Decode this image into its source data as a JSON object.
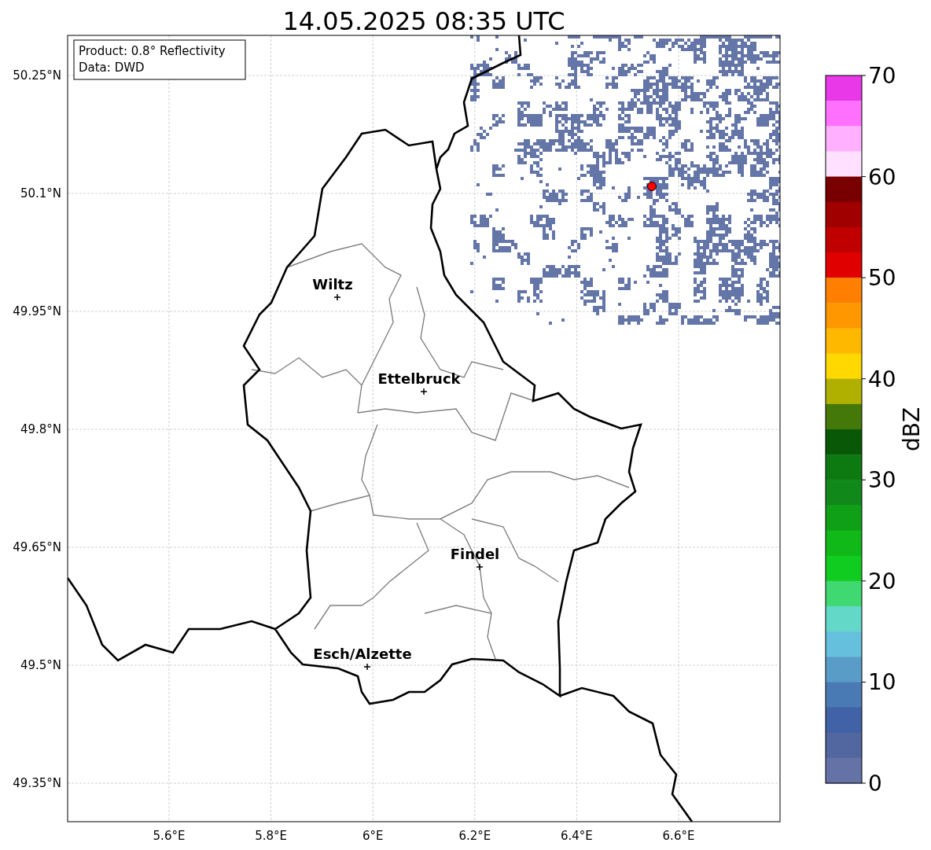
{
  "title": "14.05.2025 08:35 UTC",
  "map": {
    "x_tick_labels": [
      "5.6°E",
      "5.8°E",
      "6°E",
      "6.2°E",
      "6.4°E",
      "6.6°E"
    ],
    "y_tick_labels": [
      "50.25°N",
      "50.1°N",
      "49.95°N",
      "49.8°N",
      "49.65°N",
      "49.5°N",
      "49.35°N"
    ],
    "cities": [
      {
        "name": "Wiltz"
      },
      {
        "name": "Ettelbruck"
      },
      {
        "name": "Findel"
      },
      {
        "name": "Esch/Alzette"
      }
    ],
    "radar_site": {
      "color": "#ff0000"
    }
  },
  "info_box": {
    "lines": [
      "Product: 0.8° Reflectivity",
      "Data: DWD"
    ]
  },
  "colorbar": {
    "label": "dBZ",
    "ticks": [
      "70",
      "60",
      "50",
      "40",
      "30",
      "20",
      "10",
      "0"
    ],
    "bands": [
      {
        "color": "#e838e8"
      },
      {
        "color": "#ff70ff"
      },
      {
        "color": "#ffb0ff"
      },
      {
        "color": "#ffe0ff"
      },
      {
        "color": "#780000"
      },
      {
        "color": "#a00000"
      },
      {
        "color": "#c00000"
      },
      {
        "color": "#e00000"
      },
      {
        "color": "#ff8000"
      },
      {
        "color": "#ff9800"
      },
      {
        "color": "#ffb800"
      },
      {
        "color": "#ffd800"
      },
      {
        "color": "#b0b000"
      },
      {
        "color": "#447808"
      },
      {
        "color": "#085808"
      },
      {
        "color": "#0c7a10"
      },
      {
        "color": "#10881a"
      },
      {
        "color": "#10a018"
      },
      {
        "color": "#10b818"
      },
      {
        "color": "#10cc20"
      },
      {
        "color": "#40d870"
      },
      {
        "color": "#64d8c8"
      },
      {
        "color": "#64c0dc"
      },
      {
        "color": "#5a9cc8"
      },
      {
        "color": "#4a7ab4"
      },
      {
        "color": "#4262a8"
      },
      {
        "color": "#52669f"
      },
      {
        "color": "#6472a6"
      }
    ]
  }
}
